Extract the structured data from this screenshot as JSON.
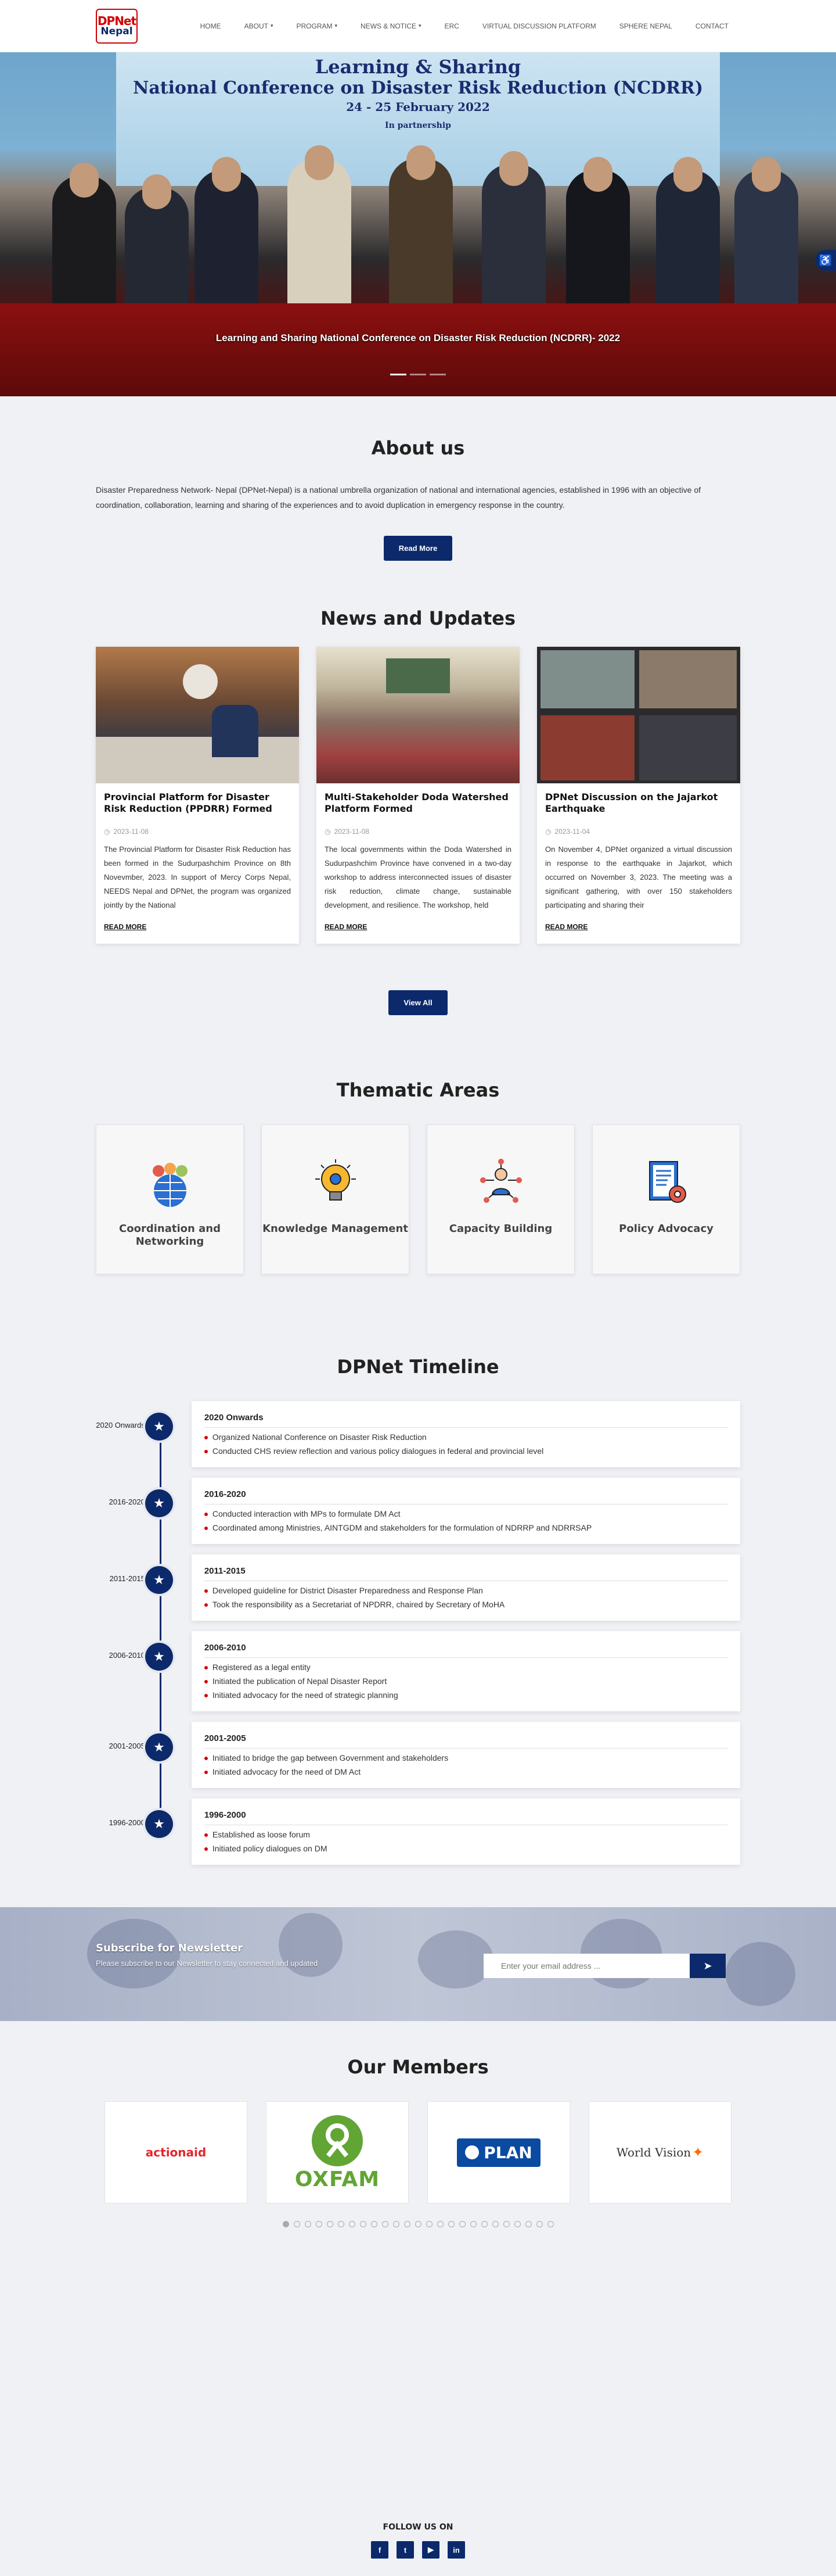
{
  "header": {
    "logo_line1": "DPNet",
    "logo_line2": "Nepal",
    "nav": [
      {
        "label": "Home",
        "caret": ""
      },
      {
        "label": "About",
        "caret": "▾"
      },
      {
        "label": "Program",
        "caret": "▾"
      },
      {
        "label": "News & Notice",
        "caret": "▾"
      },
      {
        "label": "ERC",
        "caret": ""
      },
      {
        "label": "Virtual Discussion Platform",
        "caret": ""
      },
      {
        "label": "Sphere Nepal",
        "caret": ""
      },
      {
        "label": "Contact",
        "caret": ""
      }
    ]
  },
  "hero": {
    "banner_line1": "Learning & Sharing",
    "banner_line2": "National Conference on Disaster Risk Reduction (NCDRR)",
    "banner_line3": "24 - 25 February 2022",
    "banner_line4": "In partnership",
    "caption": "Learning and Sharing National Conference on Disaster Risk Reduction (NCDRR)- 2022",
    "accessibility_icon": "accessibility-icon"
  },
  "about": {
    "title": "About us",
    "text": "Disaster Preparedness Network- Nepal (DPNet-Nepal) is a national umbrella organization of national and international agencies, established in 1996 with an objective of coordination, collaboration, learning and sharing of the experiences and to avoid duplication in emergency response in the country.",
    "button": "Read More"
  },
  "news": {
    "title": "News and Updates",
    "view_all": "View All",
    "items": [
      {
        "title": "Provincial Platform for Disaster Risk Reduction (PPDRR) Formed",
        "date": "2023-11-08",
        "desc": "The Provincial Platform for Disaster Risk Reduction has been formed in the Sudurpashchim Province on 8th Novevmber, 2023. In support of Mercy Corps Nepal, NEEDS Nepal and DPNet, the program was organized jointly by the National",
        "more": "READ MORE"
      },
      {
        "title": "Multi-Stakeholder Doda Watershed Platform Formed",
        "date": "2023-11-08",
        "desc": "The local governments within the Doda Watershed in Sudurpashchim Province have convened in a two-day workshop to address interconnected issues of disaster risk reduction, climate change, sustainable development, and resilience. The workshop, held",
        "more": "READ MORE"
      },
      {
        "title": "DPNet Discussion on the Jajarkot Earthquake",
        "date": "2023-11-04",
        "desc": "On November 4, DPNet organized a virtual discussion in response to the earthquake in Jajarkot, which occurred on November 3, 2023. The meeting was a significant gathering, with over 150 stakeholders participating and sharing their",
        "more": "READ MORE"
      }
    ]
  },
  "thematic": {
    "title": "Thematic Areas",
    "items": [
      {
        "label": "Coordination and Networking",
        "icon": "globe-people-icon"
      },
      {
        "label": "Knowledge Management",
        "icon": "lightbulb-gear-icon"
      },
      {
        "label": "Capacity Building",
        "icon": "person-network-icon"
      },
      {
        "label": "Policy Advocacy",
        "icon": "document-gear-icon"
      }
    ]
  },
  "timeline": {
    "title": "DPNet Timeline",
    "items": [
      {
        "year": "2020 Onwards",
        "heading": "2020 Onwards",
        "points": [
          "Organized National Conference on Disaster Risk Reduction",
          "Conducted CHS review reflection and various policy dialogues in federal and provincial level"
        ]
      },
      {
        "year": "2016-2020",
        "heading": "2016-2020",
        "points": [
          "Conducted interaction with MPs to formulate DM Act",
          "Coordinated among Ministries, AINTGDM and stakeholders for the formulation of NDRRP and NDRRSAP"
        ]
      },
      {
        "year": "2011-2015",
        "heading": "2011-2015",
        "points": [
          "Developed guideline for District Disaster Preparedness and Response Plan",
          "Took the responsibility as a Secretariat of NPDRR, chaired by Secretary of MoHA"
        ]
      },
      {
        "year": "2006-2010",
        "heading": "2006-2010",
        "points": [
          "Registered as a legal entity",
          "Initiated the publication of Nepal Disaster Report",
          "Initiated advocacy for the need of strategic planning"
        ]
      },
      {
        "year": "2001-2005",
        "heading": "2001-2005",
        "points": [
          "Initiated to bridge the gap between Government and stakeholders",
          "Initiated advocacy for the need of DM Act"
        ]
      },
      {
        "year": "1996-2000",
        "heading": "1996-2000",
        "points": [
          "Established as loose forum",
          "Initiated policy dialogues on DM"
        ]
      }
    ]
  },
  "newsletter": {
    "title": "Subscribe for Newsletter",
    "subtitle": "Please subscribe to our Newsletter to stay connected and updated",
    "placeholder": "Enter your email address ...",
    "submit": "➤"
  },
  "members": {
    "title": "Our Members",
    "logos": [
      "actionaid",
      "OXFAM",
      "PLAN",
      "World Vision"
    ],
    "page_dots": 25,
    "active_dot": 0
  },
  "footer": {
    "follow": "FOLLOW US ON",
    "social": [
      {
        "icon": "facebook-icon",
        "glyph": "f"
      },
      {
        "icon": "twitter-icon",
        "glyph": "t"
      },
      {
        "icon": "youtube-icon",
        "glyph": "▶"
      },
      {
        "icon": "linkedin-icon",
        "glyph": "in"
      }
    ]
  },
  "colors": {
    "primary": "#0c2a6b",
    "accent": "#d40000",
    "background": "#f0f1f5"
  }
}
